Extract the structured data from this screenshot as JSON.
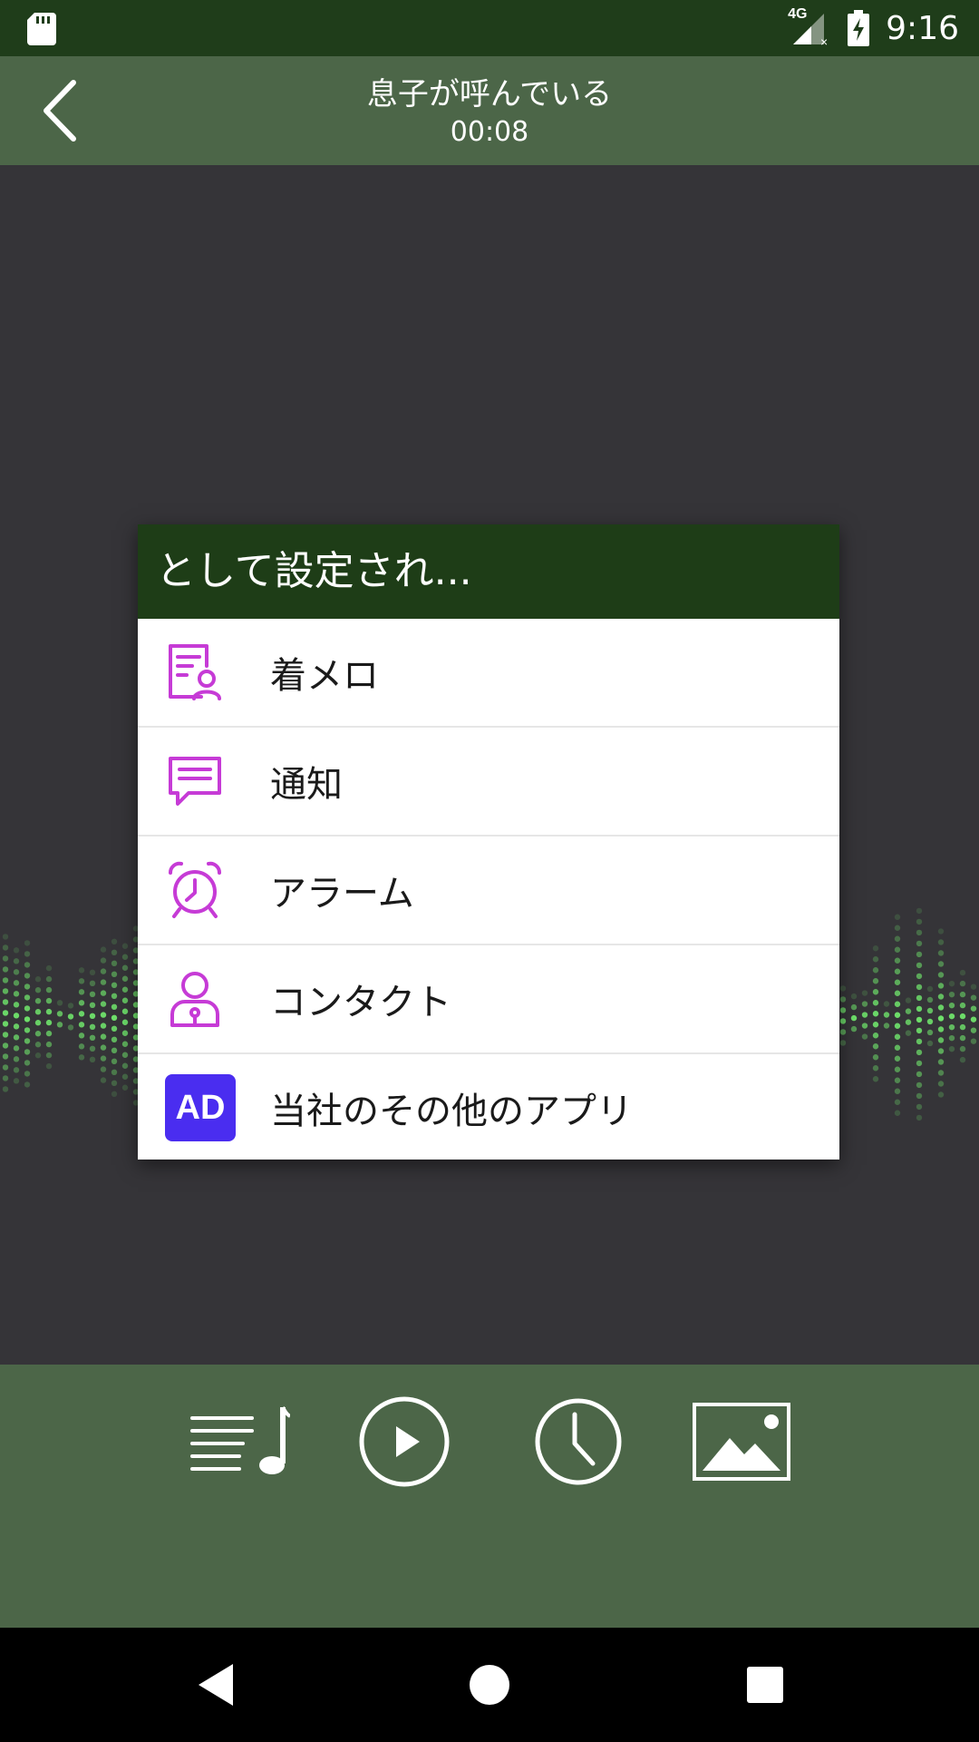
{
  "status_bar": {
    "time": "9:16",
    "network": "4G",
    "icons": [
      "sd-card-icon",
      "signal-icon",
      "battery-charging-icon"
    ]
  },
  "header": {
    "title": "息子が呼んでいる",
    "duration": "00:08",
    "back_icon": "chevron-left-icon"
  },
  "dialog": {
    "title": "として設定され...",
    "items": [
      {
        "label": "着メロ",
        "icon": "ringtone-icon"
      },
      {
        "label": "通知",
        "icon": "message-icon"
      },
      {
        "label": "アラーム",
        "icon": "alarm-clock-icon"
      },
      {
        "label": "コンタクト",
        "icon": "contact-icon"
      },
      {
        "label": "当社のその他のアプリ",
        "icon": "ad-badge",
        "badge_text": "AD"
      }
    ]
  },
  "player": {
    "controls": [
      "playlist-icon",
      "play-icon",
      "clock-icon",
      "image-icon"
    ]
  },
  "nav": {
    "buttons": [
      "back-triangle-icon",
      "home-circle-icon",
      "recents-square-icon"
    ]
  },
  "colors": {
    "status_bar": "#1f3d1a",
    "app_bar": "#4c6648",
    "dialog_header": "#1e3d17",
    "background": "#353438",
    "icon_accent": "#c63bd6",
    "ad_badge": "#4a2df0",
    "wave": "#6ee06a"
  }
}
